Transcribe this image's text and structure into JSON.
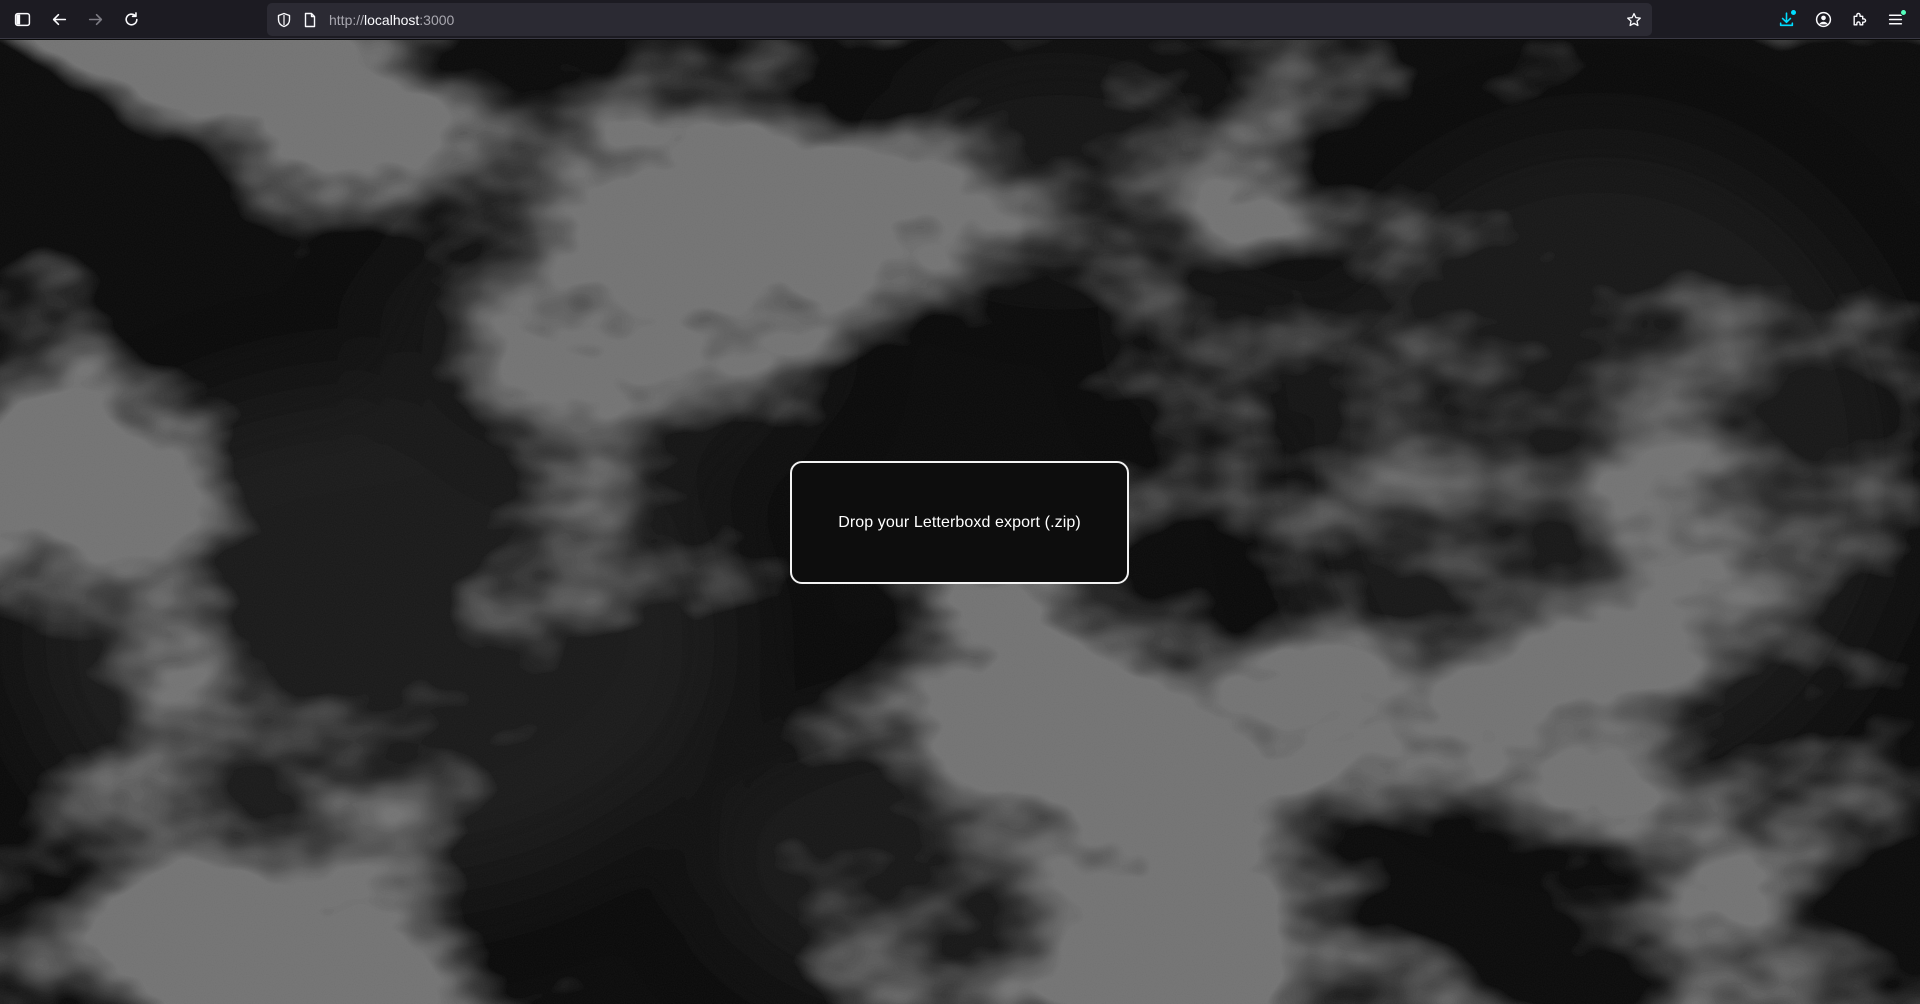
{
  "browser": {
    "url_prefix": "http://",
    "url_host": "localhost",
    "url_suffix": ":3000",
    "icons": {
      "sidebar": "sidebar-toggle-icon",
      "back": "back-arrow-icon",
      "forward": "forward-arrow-icon",
      "reload": "reload-icon",
      "tracking": "shield-icon",
      "page": "page-icon",
      "bookmark": "star-icon",
      "downloads": "download-icon",
      "account": "account-icon",
      "extensions": "puzzle-icon",
      "menu": "hamburger-menu-icon"
    },
    "colors": {
      "download_accent": "#00ddff",
      "badge_dot": "#54ffbd"
    }
  },
  "page": {
    "dropzone_label": "Drop your Letterboxd export (.zip)",
    "colors": {
      "background": "#090909",
      "dropzone_border": "#f2f2f2"
    }
  }
}
